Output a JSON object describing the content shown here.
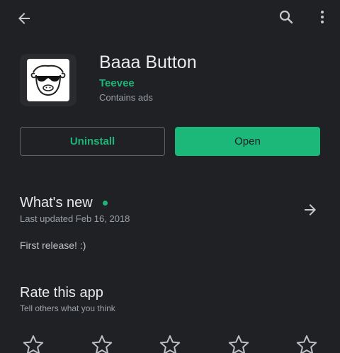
{
  "app": {
    "title": "Baaa Button",
    "developer": "Teevee",
    "ads_note": "Contains ads"
  },
  "icons": {
    "back": "arrow-back-icon",
    "search": "search-icon",
    "more": "more-vert-icon",
    "details": "arrow-forward-icon",
    "star": "star-outline-icon"
  },
  "actions": {
    "uninstall_label": "Uninstall",
    "open_label": "Open"
  },
  "whats_new": {
    "title": "What's new",
    "updated": "Last updated Feb 16, 2018",
    "notes": "First release! :)"
  },
  "rate": {
    "title": "Rate this app",
    "subtitle": "Tell others what you think",
    "star_count": 5
  },
  "colors": {
    "background": "#202124",
    "accent": "#1fb57a",
    "open_button": "#1cb879"
  }
}
